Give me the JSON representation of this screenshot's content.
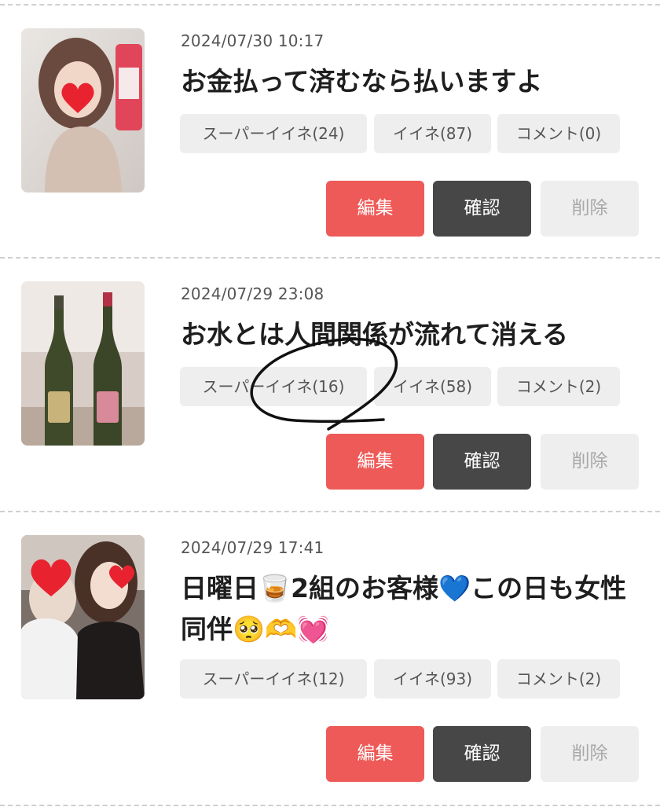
{
  "posts": [
    {
      "date": "2024/07/30 10:17",
      "title": "お金払って済むなら払いますよ",
      "super_like": "スーパーイイネ(24)",
      "like": "イイネ(87)",
      "comment": "コメント(0)",
      "edit": "編集",
      "check": "確認",
      "delete": "削除"
    },
    {
      "date": "2024/07/29 23:08",
      "title": "お水とは人間関係が流れて消える",
      "super_like": "スーパーイイネ(16)",
      "like": "イイネ(58)",
      "comment": "コメント(2)",
      "edit": "編集",
      "check": "確認",
      "delete": "削除"
    },
    {
      "date": "2024/07/29 17:41",
      "title": "日曜日🥃2組のお客様💙この日も女性同伴🥺🫶💓",
      "super_like": "スーパーイイネ(12)",
      "like": "イイネ(93)",
      "comment": "コメント(2)",
      "edit": "編集",
      "check": "確認",
      "delete": "削除"
    }
  ],
  "colors": {
    "edit": "#ee5a57",
    "check": "#474747",
    "delete_bg": "#eeeeee",
    "tag_bg": "#eeeeee"
  }
}
